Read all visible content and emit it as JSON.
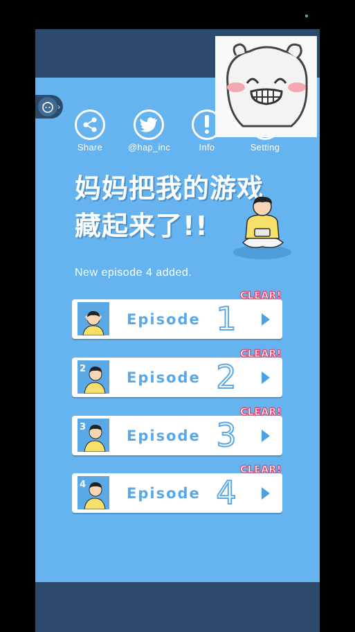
{
  "top_buttons": [
    {
      "label": "Share",
      "icon": "share-icon"
    },
    {
      "label": "@hap_inc",
      "icon": "twitter-bird-icon"
    },
    {
      "label": "Info",
      "icon": "exclamation-icon"
    },
    {
      "label": "Setting",
      "icon": "gear-icon"
    }
  ],
  "title": {
    "line1": "妈妈把我的游戏",
    "line2": "藏起来了!!"
  },
  "notice": "New episode 4 added.",
  "episodes": [
    {
      "label": "Episode",
      "number": "1",
      "badge": "CLEAR!"
    },
    {
      "label": "Episode",
      "number": "2",
      "badge": "CLEAR!"
    },
    {
      "label": "Episode",
      "number": "3",
      "badge": "CLEAR!"
    },
    {
      "label": "Episode",
      "number": "4",
      "badge": "CLEAR!"
    }
  ],
  "colors": {
    "background": "#65b4ef",
    "band": "#2c4a6b",
    "accent": "#5aa8e6",
    "clear_badge": "#e23c66"
  }
}
